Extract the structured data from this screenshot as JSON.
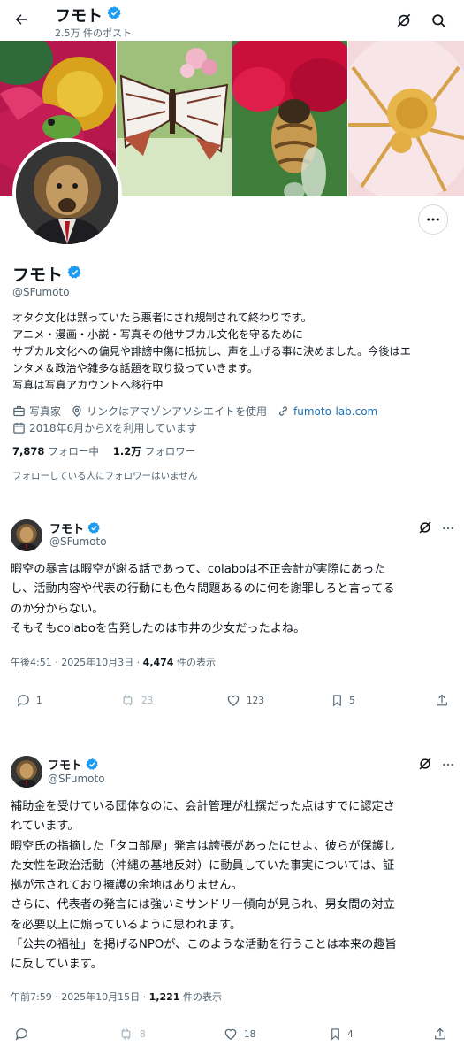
{
  "header": {
    "name": "フモト",
    "post_count": "2.5万 件のポスト"
  },
  "profile": {
    "name": "フモト",
    "handle": "@SFumoto",
    "bio": [
      "オタク文化は黙っていたら悪者にされ規制されて終わりです。",
      "アニメ・漫画・小説・写真その他サブカル文化を守るために",
      "サブカル文化への偏見や誹謗中傷に抵抗し、声を上げる事に決めました。今後はエ",
      "ンタメ＆政治や雑多な話題を取り扱っていきます。",
      "写真は写真アカウントへ移行中"
    ],
    "category": "写真家",
    "location": "リンクはアマゾンアソシエイトを使用",
    "website": "fumoto-lab.com",
    "joined": "2018年6月からXを利用しています",
    "following_count": "7,878",
    "following_label": "フォロー中",
    "followers_count": "1.2万",
    "followers_label": "フォロワー",
    "no_common_followers": "フォローしている人にフォロワーはいません"
  },
  "tweets": [
    {
      "name": "フモト",
      "handle": "@SFumoto",
      "lines": [
        "暇空の暴言は暇空が謝る話であって、colaboは不正会計が実際にあった",
        "し、活動内容や代表の行動にも色々問題あるのに何を謝罪しろと言ってる",
        "のか分からない。",
        "そもそもcolaboを告発したのは市井の少女だったよね。"
      ],
      "time": "午後4:51 · 2025年10月3日 · ",
      "views": "4,474",
      "views_suffix": " 件の表示",
      "replies": "1",
      "reposts": "23",
      "likes": "123",
      "bookmarks": "5"
    },
    {
      "name": "フモト",
      "handle": "@SFumoto",
      "lines": [
        "補助金を受けている団体なのに、会計管理が杜撰だった点はすでに認定さ",
        "れています。",
        "暇空氏の指摘した「タコ部屋」発言は誇張があったにせよ、彼らが保護し",
        "た女性を政治活動（沖縄の基地反対）に動員していた事実については、証",
        "拠が示されており擁護の余地はありません。",
        "さらに、代表者の発言には強いミサンドリー傾向が見られ、男女間の対立",
        "を必要以上に煽っているように思われます。",
        "「公共の福祉」を掲げるNPOが、このような活動を行うことは本来の趣旨",
        "に反しています。"
      ],
      "time": "午前7:59 · 2025年10月15日 · ",
      "views": "1,221",
      "views_suffix": " 件の表示",
      "replies": "",
      "reposts": "8",
      "likes": "18",
      "bookmarks": "4"
    }
  ],
  "colors": {
    "text": "#0f1419",
    "muted": "#536471",
    "link": "#1d6fb3",
    "verified": "#1d9bf0"
  }
}
